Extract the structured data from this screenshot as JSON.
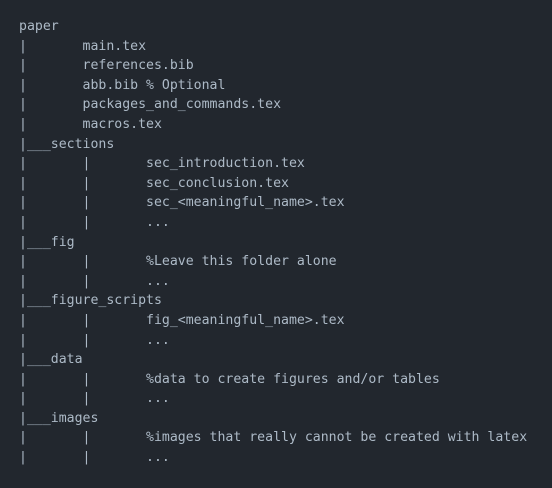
{
  "code_lines": [
    "paper",
    "|       main.tex",
    "|       references.bib",
    "|       abb.bib % Optional",
    "|       packages_and_commands.tex",
    "|       macros.tex",
    "|___sections",
    "|       |       sec_introduction.tex",
    "|       |       sec_conclusion.tex",
    "|       |       sec_<meaningful_name>.tex",
    "|       |       ...",
    "|___fig",
    "|       |       %Leave this folder alone",
    "|       |       ...",
    "|___figure_scripts",
    "|       |       fig_<meaningful_name>.tex",
    "|       |       ...",
    "|___data",
    "|       |       %data to create figures and/or tables",
    "|       |       ...",
    "|___images",
    "|       |       %images that really cannot be created with latex",
    "|       |       ..."
  ]
}
